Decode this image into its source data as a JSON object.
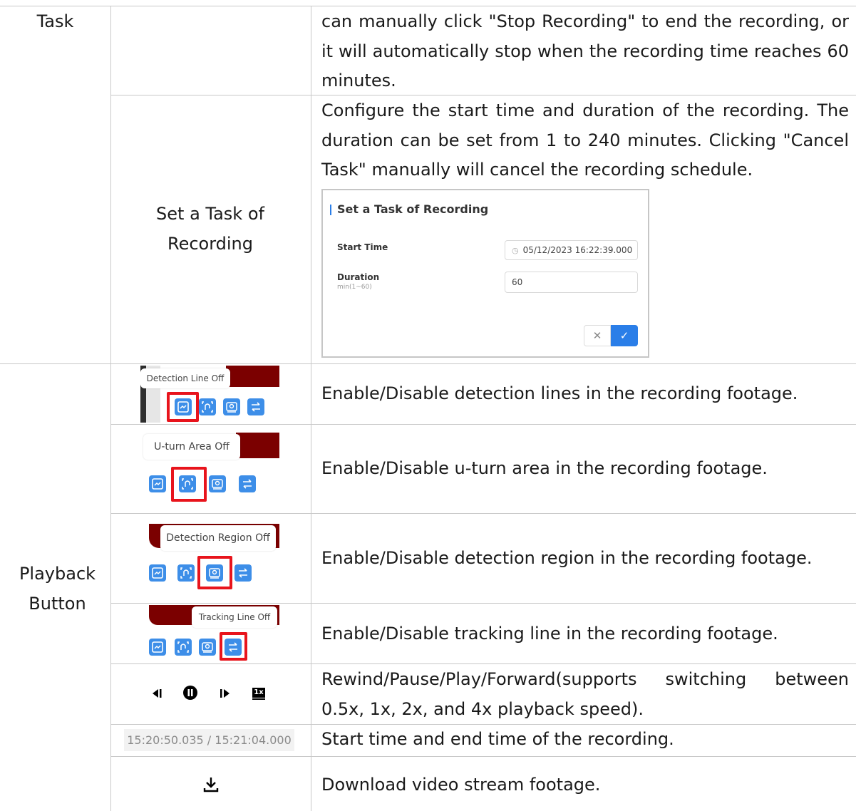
{
  "rows": {
    "task_label": "Task",
    "task_desc_cont": "can manually click \"Stop Recording\" to end the recording, or it will automatically stop when the recording time reaches 60 minutes.",
    "set_task_label": "Set a Task of Recording",
    "set_task_desc": "Configure the start time and duration of the recording. The duration can be set from 1 to 240 minutes. Clicking \"Cancel Task\" manually will cancel the recording schedule.",
    "playback_label": "Playback Button",
    "detection_line_desc": "Enable/Disable detection lines in the recording footage.",
    "uturn_desc": "Enable/Disable u-turn area in the recording footage.",
    "detection_region_desc": "Enable/Disable detection region in the recording footage.",
    "tracking_desc": "Enable/Disable tracking line in the recording footage.",
    "controls_desc": "Rewind/Pause/Play/Forward(supports switching between 0.5x, 1x, 2x, and 4x playback speed).",
    "time_desc": "Start time and end time of the recording.",
    "download_desc": "Download video stream footage."
  },
  "dialog": {
    "title": "Set a Task of Recording",
    "start_time_label": "Start Time",
    "start_time_value": "05/12/2023 16:22:39.000",
    "duration_label": "Duration",
    "duration_hint": "min(1~60)",
    "duration_value": "60",
    "cancel_symbol": "✕",
    "confirm_symbol": "✓"
  },
  "tooltips": {
    "detection_line": "Detection Line Off",
    "uturn": "U-turn Area Off",
    "detection_region": "Detection Region Off",
    "tracking_line": "Tracking Line Off"
  },
  "playback": {
    "speed_label": "1x",
    "time_range": "15:20:50.035 / 15:21:04.000"
  },
  "colors": {
    "accent_blue": "#3d8ee8",
    "highlight_red": "#e8141c",
    "maroon": "#7b0000"
  },
  "icons": [
    "detection-line-icon",
    "uturn-area-icon",
    "detection-region-icon",
    "tracking-line-icon",
    "rewind-icon",
    "pause-icon",
    "forward-icon",
    "speed-icon",
    "download-icon"
  ]
}
